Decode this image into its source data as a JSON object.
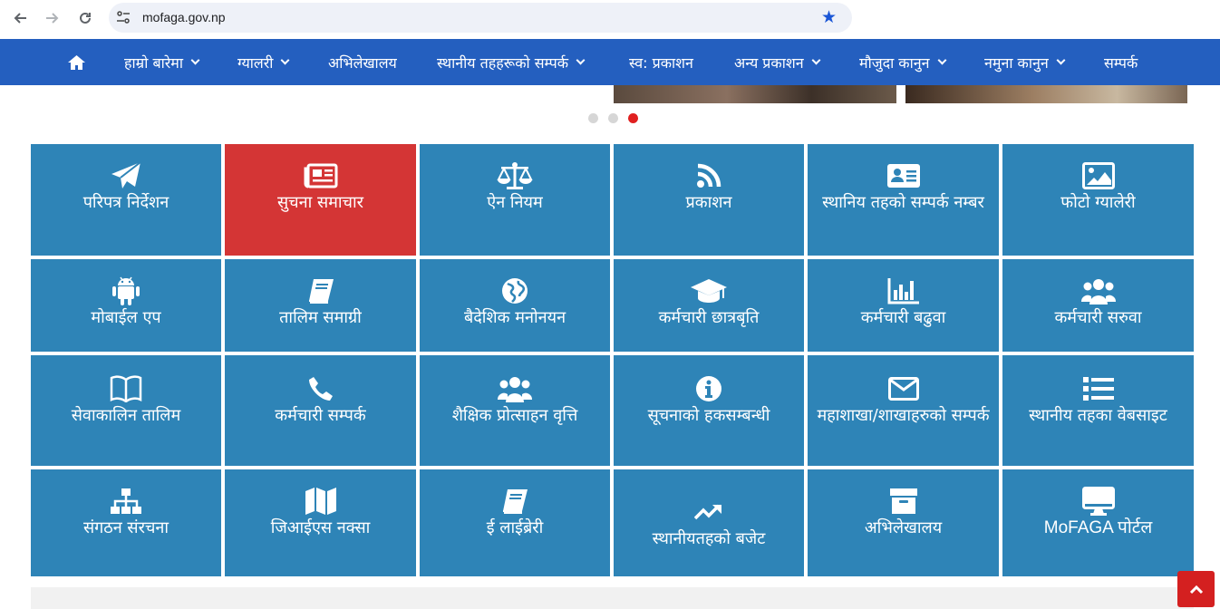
{
  "browser": {
    "url": "mofaga.gov.np"
  },
  "nav": {
    "items": [
      {
        "label": "हाम्रो बारेमा",
        "dropdown": true
      },
      {
        "label": "ग्यालरी",
        "dropdown": true
      },
      {
        "label": "अभिलेखालय",
        "dropdown": false
      },
      {
        "label": "स्थानीय तहहरूको सम्पर्क",
        "dropdown": true
      },
      {
        "label": "स्व: प्रकाशन",
        "dropdown": false
      },
      {
        "label": "अन्य प्रकाशन",
        "dropdown": true
      },
      {
        "label": "मौजुदा कानुन",
        "dropdown": true
      },
      {
        "label": "नमुना कानुन",
        "dropdown": true
      },
      {
        "label": "सम्पर्क",
        "dropdown": false
      }
    ]
  },
  "carousel": {
    "slide_count": 3,
    "active_index": 2
  },
  "colors": {
    "nav_bg": "#245fbf",
    "tile_bg": "#2e84b7",
    "tile_active_bg": "#d43535",
    "back_to_top_bg": "#d42020"
  },
  "tiles": [
    {
      "label": "परिपत्र निर्देशन",
      "icon": "paper-plane-icon"
    },
    {
      "label": "सुचना समाचार",
      "icon": "newspaper-icon",
      "active": true
    },
    {
      "label": "ऐन नियम",
      "icon": "balance-scale-icon"
    },
    {
      "label": "प्रकाशन",
      "icon": "rss-icon"
    },
    {
      "label": "स्थानिय तहको सम्पर्क नम्बर",
      "icon": "address-card-icon"
    },
    {
      "label": "फोटो ग्यालेरी",
      "icon": "image-icon"
    },
    {
      "label": "मोबाईल एप",
      "icon": "android-icon"
    },
    {
      "label": "तालिम समाग्री",
      "icon": "book-icon"
    },
    {
      "label": "बैदेशिक मनोनयन",
      "icon": "globe-icon"
    },
    {
      "label": "कर्मचारी छात्रबृति",
      "icon": "graduation-cap-icon"
    },
    {
      "label": "कर्मचारी बढुवा",
      "icon": "bar-chart-icon"
    },
    {
      "label": "कर्मचारी सरुवा",
      "icon": "users-icon"
    },
    {
      "label": "सेवाकालिन तालिम",
      "icon": "open-book-icon"
    },
    {
      "label": "कर्मचारी सम्पर्क",
      "icon": "phone-icon"
    },
    {
      "label": "शैक्षिक प्रोत्साहन वृत्ति",
      "icon": "users-icon"
    },
    {
      "label": "सूचनाको हकसम्बन्धी",
      "icon": "info-circle-icon"
    },
    {
      "label": "महाशाखा/शाखाहरुको सम्पर्क",
      "icon": "envelope-icon"
    },
    {
      "label": "स्थानीय तहका वेबसाइट",
      "icon": "list-icon"
    },
    {
      "label": "संगठन संरचना",
      "icon": "sitemap-icon"
    },
    {
      "label": "जिआईएस नक्सा",
      "icon": "map-icon"
    },
    {
      "label": "ई लाईब्रेरी",
      "icon": "book-icon"
    },
    {
      "label": "स्थानीयतहको बजेट",
      "icon": "trend-up-icon"
    },
    {
      "label": "अभिलेखालय",
      "icon": "archive-icon"
    },
    {
      "label": "MoFAGA पोर्टल",
      "icon": "desktop-icon"
    }
  ]
}
